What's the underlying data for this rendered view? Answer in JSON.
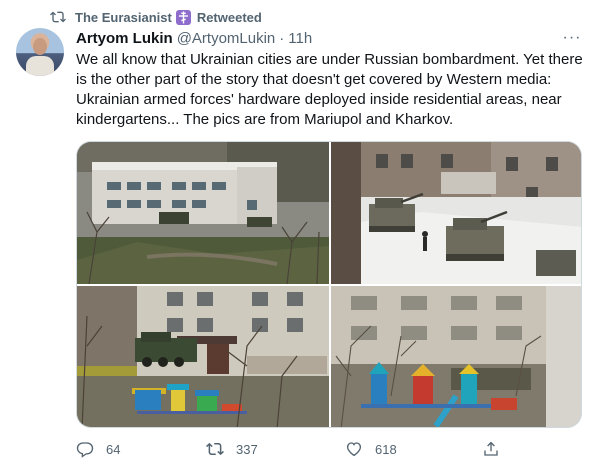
{
  "retweet_context": {
    "account": "The Eurasianist",
    "badge_icon": "orthodox-cross-icon",
    "action": "Retweeted"
  },
  "tweet": {
    "author_name": "Artyom Lukin",
    "handle": "@ArtyomLukin",
    "separator": "·",
    "time": "11h",
    "more_icon": "···",
    "text": "We all know that Ukrainian cities are under Russian bombardment. Yet there is the other part of the story that doesn't get covered by Western media: Ukrainian armed forces' hardware deployed inside residential areas, near kindergartens... The pics are from Mariupol and Kharkov."
  },
  "media": {
    "photos": [
      "photo-kindergarten-building-with-tanks",
      "photo-tanks-in-snowy-courtyard",
      "photo-apc-near-apartment-playground",
      "photo-military-vehicle-behind-playground"
    ]
  },
  "actions": {
    "reply_count": "64",
    "retweet_count": "337",
    "like_count": "618"
  },
  "colors": {
    "text_primary": "#0f1419",
    "text_secondary": "#536471",
    "border": "#cfd9de",
    "badge": "#8e6ccc"
  }
}
